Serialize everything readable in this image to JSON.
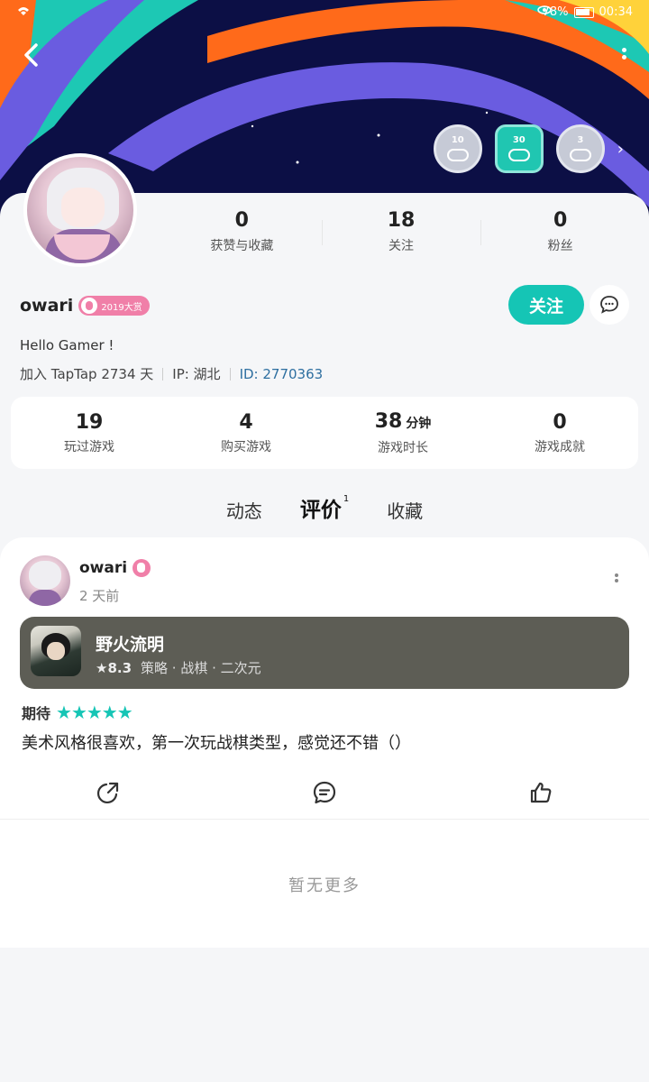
{
  "status_bar": {
    "battery": "78%",
    "time": "00:34"
  },
  "header": {
    "badges": [
      {
        "label": "10"
      },
      {
        "label": "30"
      },
      {
        "label": "3"
      }
    ]
  },
  "profile": {
    "counts": [
      {
        "value": "0",
        "label": "获赞与收藏"
      },
      {
        "value": "18",
        "label": "关注"
      },
      {
        "value": "0",
        "label": "粉丝"
      }
    ],
    "username": "owari",
    "year_badge": "2019大赏",
    "follow_label": "关注",
    "bio": "Hello Gamer !",
    "join_text": "加入 TapTap 2734 天",
    "ip_text": "IP: 湖北",
    "id_text": "ID: 2770363"
  },
  "stats": [
    {
      "value": "19",
      "unit": "",
      "label": "玩过游戏"
    },
    {
      "value": "4",
      "unit": "",
      "label": "购买游戏"
    },
    {
      "value": "38",
      "unit": "分钟",
      "label": "游戏时长"
    },
    {
      "value": "0",
      "unit": "",
      "label": "游戏成就"
    }
  ],
  "tabs": [
    {
      "label": "动态"
    },
    {
      "label": "评价",
      "count": "1"
    },
    {
      "label": "收藏"
    }
  ],
  "review": {
    "author": "owari",
    "time": "2 天前",
    "game": {
      "title": "野火流明",
      "score": "★8.3",
      "tags": "策略 · 战棋 · 二次元"
    },
    "rating_label": "期待",
    "stars": "★★★★★",
    "text": "美术风格很喜欢，第一次玩战棋类型，感觉还不错（）"
  },
  "no_more_text": "暂无更多",
  "colors": {
    "accent": "#15c5b5",
    "game_card_bg": "#5d5d55",
    "banner_bg": "#0c0f45"
  }
}
